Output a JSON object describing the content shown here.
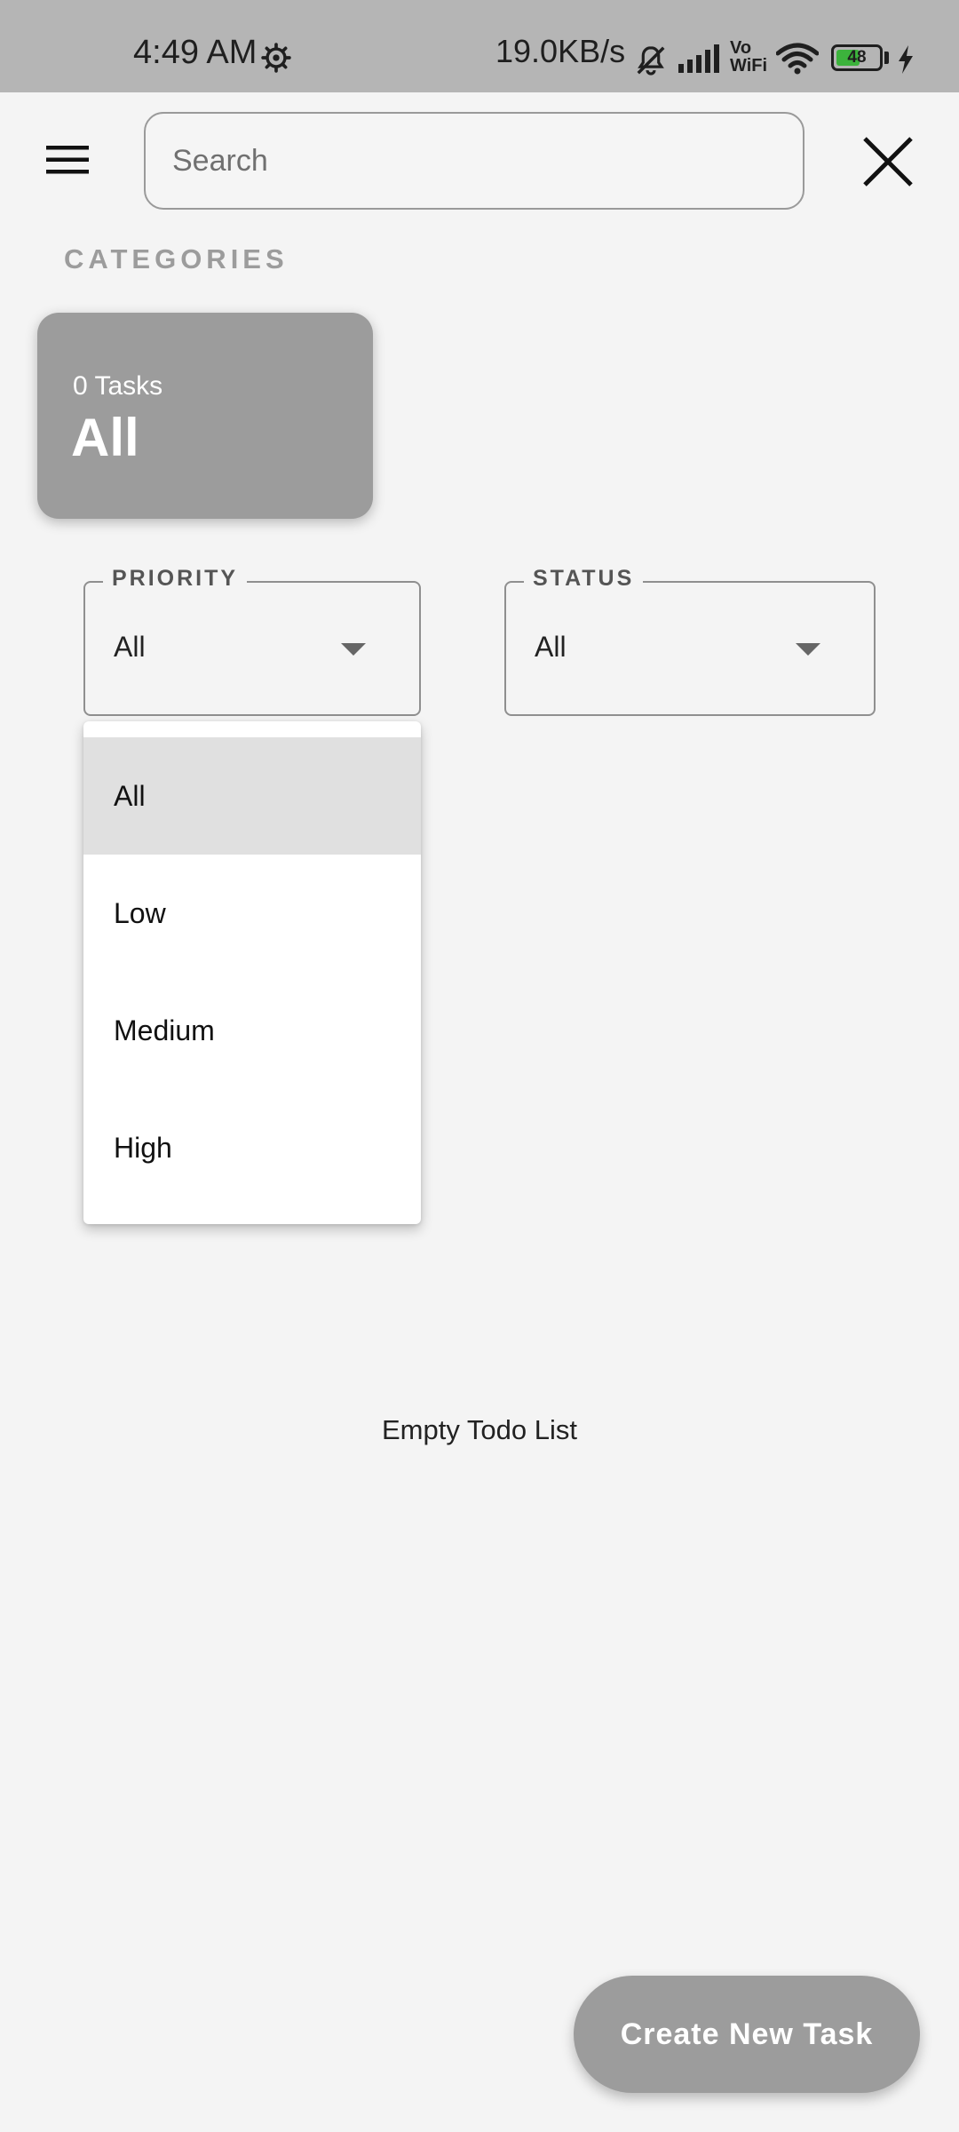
{
  "status_bar": {
    "time": "4:49 AM",
    "network_speed": "19.0KB/s",
    "vowifi_top": "Vo",
    "vowifi_bottom": "WiFi",
    "battery_level": "48",
    "icons": [
      "gear-icon",
      "mute-bell-icon",
      "signal-icon",
      "wifi-icon",
      "battery-icon",
      "charging-bolt-icon"
    ]
  },
  "app_bar": {
    "menu_icon": "hamburger-menu-icon",
    "search_placeholder": "Search",
    "close_icon": "close-icon"
  },
  "categories": {
    "label": "CATEGORIES",
    "items": [
      {
        "count_label": "0 Tasks",
        "name": "All"
      }
    ]
  },
  "filters": {
    "priority": {
      "label": "PRIORITY",
      "value": "All"
    },
    "status": {
      "label": "STATUS",
      "value": "All"
    }
  },
  "priority_dropdown": {
    "options": [
      "All",
      "Low",
      "Medium",
      "High"
    ],
    "selected": "All"
  },
  "empty_state": "Empty Todo List",
  "fab_label": "Create New Task",
  "colors": {
    "status_bar_bg": "#b5b5b5",
    "page_bg": "#f4f4f4",
    "card_bg": "#9c9c9c",
    "selected_option_bg": "#e0e0e0"
  }
}
